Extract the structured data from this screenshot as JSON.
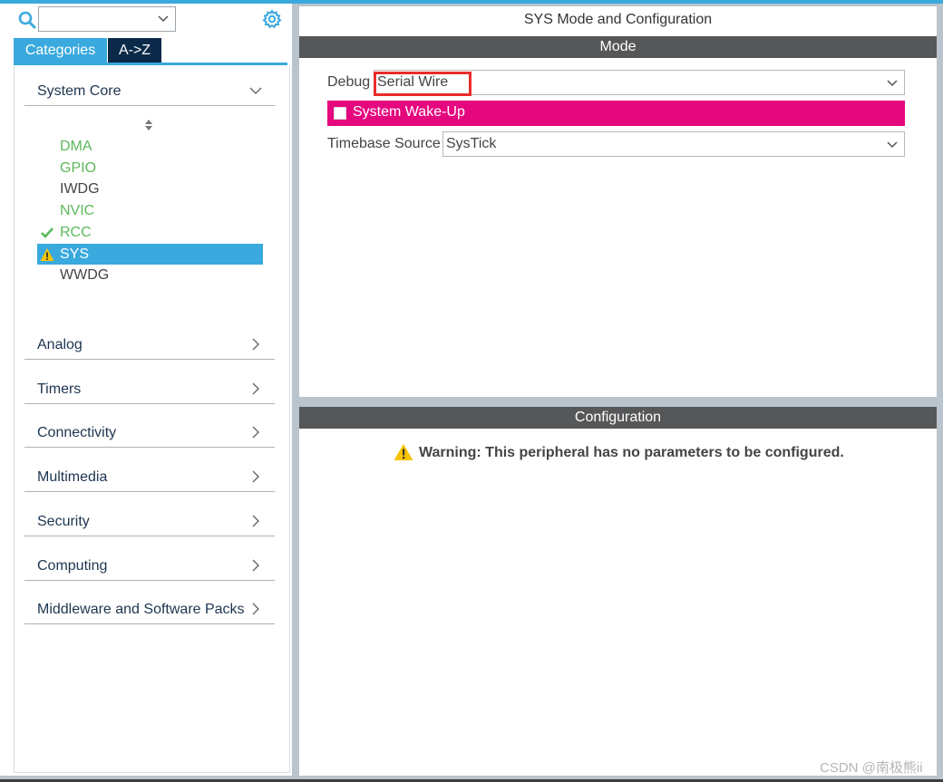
{
  "sidebar": {
    "search": {
      "value": ""
    },
    "tabs": [
      {
        "label": "Categories",
        "active": true
      },
      {
        "label": "A->Z",
        "active": false
      }
    ],
    "sections": [
      {
        "label": "System Core",
        "expanded": true
      },
      {
        "label": "Analog",
        "expanded": false
      },
      {
        "label": "Timers",
        "expanded": false
      },
      {
        "label": "Connectivity",
        "expanded": false
      },
      {
        "label": "Multimedia",
        "expanded": false
      },
      {
        "label": "Security",
        "expanded": false
      },
      {
        "label": "Computing",
        "expanded": false
      },
      {
        "label": "Middleware and Software Packs",
        "expanded": false
      }
    ],
    "system_core_items": [
      {
        "label": "DMA",
        "status": "configured"
      },
      {
        "label": "GPIO",
        "status": "configured"
      },
      {
        "label": "IWDG",
        "status": "none"
      },
      {
        "label": "NVIC",
        "status": "configured"
      },
      {
        "label": "RCC",
        "status": "check"
      },
      {
        "label": "SYS",
        "status": "warning",
        "selected": true
      },
      {
        "label": "WWDG",
        "status": "none"
      }
    ]
  },
  "main": {
    "title": "SYS Mode and Configuration",
    "mode": {
      "header": "Mode",
      "debug": {
        "label": "Debug",
        "value": "Serial Wire"
      },
      "wakeup": {
        "label": "System Wake-Up",
        "checked": false
      },
      "timebase": {
        "label": "Timebase Source",
        "value": "SysTick"
      }
    },
    "configuration": {
      "header": "Configuration",
      "warning": "Warning: This peripheral has no parameters to be configured."
    }
  },
  "watermark": "CSDN @南极熊ii",
  "colors": {
    "accent_blue": "#3aa9dd",
    "dark_navy": "#0b2a4a",
    "header_gray": "#555759",
    "wake_magenta": "#e5077e",
    "configured_green": "#5cb85c",
    "warning_yellow": "#f5c400",
    "highlight_red": "#ea2b2b"
  }
}
